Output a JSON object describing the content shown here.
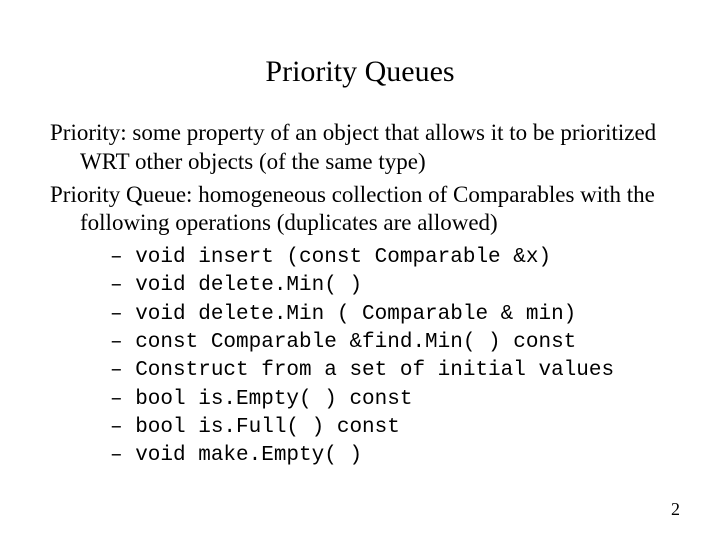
{
  "title": "Priority Queues",
  "para1": "Priority: some property of an object that allows it to be prioritized WRT other objects (of the same type)",
  "para2": "Priority Queue: homogeneous collection of Comparables with the following operations (duplicates are allowed)",
  "ops": [
    "– void insert (const Comparable &x)",
    "– void delete.Min( )",
    "– void delete.Min ( Comparable & min)",
    "– const Comparable &find.Min( ) const",
    "– Construct from a set of initial values",
    "– bool is.Empty( ) const",
    "– bool is.Full( ) const",
    "– void make.Empty( )"
  ],
  "page_number": "2"
}
